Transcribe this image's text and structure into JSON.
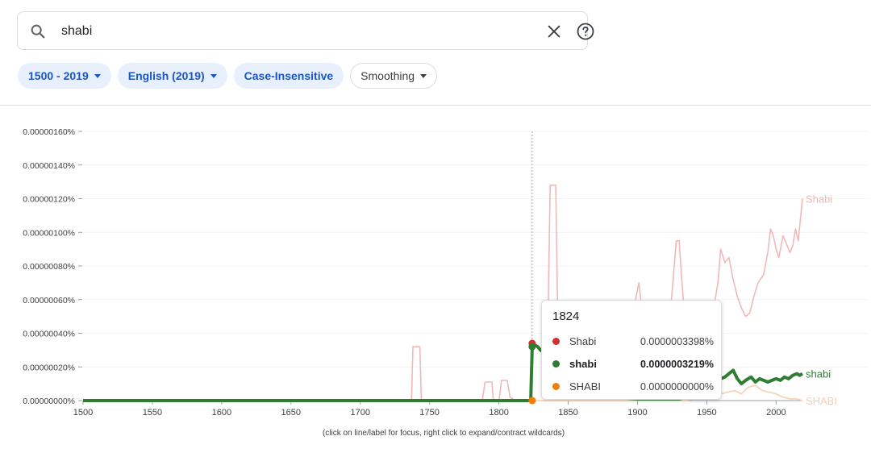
{
  "search": {
    "query": "shabi"
  },
  "filters": {
    "year_range": "1500 - 2019",
    "corpus": "English (2019)",
    "case": "Case-Insensitive",
    "smoothing": "Smoothing"
  },
  "colors": {
    "Shabi": "#d32f2f",
    "shabi": "#2e7d32",
    "SHABI": "#f57c00",
    "chip_bg": "#e8f0fe",
    "chip_text": "#1a56c4"
  },
  "tooltip": {
    "year": "1824",
    "rows": [
      {
        "name": "Shabi",
        "value": "0.0000003398%"
      },
      {
        "name": "shabi",
        "value": "0.0000003219%"
      },
      {
        "name": "SHABI",
        "value": "0.0000000000%"
      }
    ]
  },
  "footnote": "(click on line/label for focus, right click to expand/contract wildcards)",
  "chart_data": {
    "type": "line",
    "x_ticks": [
      "1500",
      "1550",
      "1600",
      "1650",
      "1700",
      "1750",
      "1800",
      "1850",
      "1900",
      "1950",
      "2000"
    ],
    "y_ticks": [
      "0.00000000%",
      "0.00000020%",
      "0.00000040%",
      "0.00000060%",
      "0.00000080%",
      "0.00000100%",
      "0.00000120%",
      "0.00000140%",
      "0.00000160%"
    ],
    "xlim": [
      1500,
      2019
    ],
    "ylim": [
      0,
      1.6e-06
    ],
    "hover_year": 1824,
    "series": [
      {
        "name": "Shabi",
        "label": "Shabi",
        "color": "#f2b8b8",
        "focus_color": "#d32f2f",
        "points": [
          [
            1500,
            0
          ],
          [
            1737,
            0
          ],
          [
            1738,
            0.32
          ],
          [
            1743,
            0.32
          ],
          [
            1744,
            0
          ],
          [
            1788,
            0
          ],
          [
            1790,
            0.11
          ],
          [
            1795,
            0.11
          ],
          [
            1796,
            0
          ],
          [
            1800,
            0
          ],
          [
            1802,
            0.12
          ],
          [
            1806,
            0.12
          ],
          [
            1808,
            0.02
          ],
          [
            1812,
            0
          ],
          [
            1823,
            0
          ],
          [
            1824,
            0.34
          ],
          [
            1828,
            0.32
          ],
          [
            1835,
            0.28
          ],
          [
            1837,
            1.28
          ],
          [
            1841,
            1.28
          ],
          [
            1843,
            0.18
          ],
          [
            1848,
            0.08
          ],
          [
            1852,
            0.28
          ],
          [
            1856,
            0.18
          ],
          [
            1862,
            0.05
          ],
          [
            1868,
            0.08
          ],
          [
            1875,
            0.02
          ],
          [
            1885,
            0.02
          ],
          [
            1890,
            0.08
          ],
          [
            1895,
            0.35
          ],
          [
            1899,
            0.62
          ],
          [
            1901,
            0.7
          ],
          [
            1903,
            0.55
          ],
          [
            1907,
            0.28
          ],
          [
            1912,
            0.1
          ],
          [
            1918,
            0.18
          ],
          [
            1924,
            0.55
          ],
          [
            1928,
            0.95
          ],
          [
            1930,
            0.95
          ],
          [
            1933,
            0.6
          ],
          [
            1937,
            0.4
          ],
          [
            1943,
            0.3
          ],
          [
            1950,
            0.38
          ],
          [
            1955,
            0.55
          ],
          [
            1958,
            0.7
          ],
          [
            1960,
            0.9
          ],
          [
            1963,
            0.82
          ],
          [
            1966,
            0.85
          ],
          [
            1969,
            0.72
          ],
          [
            1972,
            0.62
          ],
          [
            1975,
            0.55
          ],
          [
            1978,
            0.5
          ],
          [
            1981,
            0.52
          ],
          [
            1984,
            0.62
          ],
          [
            1987,
            0.7
          ],
          [
            1991,
            0.75
          ],
          [
            1994,
            0.88
          ],
          [
            1996,
            1.02
          ],
          [
            1998,
            0.98
          ],
          [
            2000,
            0.9
          ],
          [
            2002,
            0.85
          ],
          [
            2005,
            0.98
          ],
          [
            2008,
            0.92
          ],
          [
            2010,
            0.88
          ],
          [
            2012,
            0.92
          ],
          [
            2014,
            1.02
          ],
          [
            2016,
            0.95
          ],
          [
            2019,
            1.2
          ]
        ]
      },
      {
        "name": "shabi",
        "label": "shabi",
        "color": "#2e7d32",
        "focus_color": "#2e7d32",
        "points": [
          [
            1500,
            0
          ],
          [
            1822,
            0
          ],
          [
            1823,
            0
          ],
          [
            1824,
            0.32
          ],
          [
            1826,
            0.33
          ],
          [
            1828,
            0.32
          ],
          [
            1830,
            0.3
          ],
          [
            1832,
            0.29
          ],
          [
            1835,
            0.28
          ],
          [
            1838,
            0.24
          ],
          [
            1841,
            0.23
          ],
          [
            1880,
            0.02
          ],
          [
            1900,
            0.01
          ],
          [
            1930,
            0.01
          ],
          [
            1947,
            0.04
          ],
          [
            1952,
            0.06
          ],
          [
            1956,
            0.1
          ],
          [
            1960,
            0.13
          ],
          [
            1963,
            0.14
          ],
          [
            1966,
            0.16
          ],
          [
            1969,
            0.18
          ],
          [
            1972,
            0.13
          ],
          [
            1975,
            0.1
          ],
          [
            1978,
            0.12
          ],
          [
            1982,
            0.14
          ],
          [
            1985,
            0.11
          ],
          [
            1988,
            0.13
          ],
          [
            1991,
            0.12
          ],
          [
            1994,
            0.11
          ],
          [
            1997,
            0.12
          ],
          [
            2000,
            0.13
          ],
          [
            2003,
            0.12
          ],
          [
            2006,
            0.14
          ],
          [
            2009,
            0.13
          ],
          [
            2012,
            0.15
          ],
          [
            2015,
            0.16
          ],
          [
            2017,
            0.15
          ],
          [
            2019,
            0.16
          ]
        ]
      },
      {
        "name": "SHABI",
        "label": "SHABI",
        "color": "#f7cfae",
        "focus_color": "#f57c00",
        "points": [
          [
            1500,
            0
          ],
          [
            1935,
            0
          ],
          [
            1945,
            0.02
          ],
          [
            1955,
            0.03
          ],
          [
            1965,
            0.05
          ],
          [
            1970,
            0.06
          ],
          [
            1975,
            0.04
          ],
          [
            1980,
            0.08
          ],
          [
            1985,
            0.09
          ],
          [
            1990,
            0.06
          ],
          [
            1995,
            0.05
          ],
          [
            2000,
            0.04
          ],
          [
            2005,
            0.02
          ],
          [
            2010,
            0.01
          ],
          [
            2015,
            0.01
          ],
          [
            2019,
            0
          ]
        ]
      }
    ]
  }
}
